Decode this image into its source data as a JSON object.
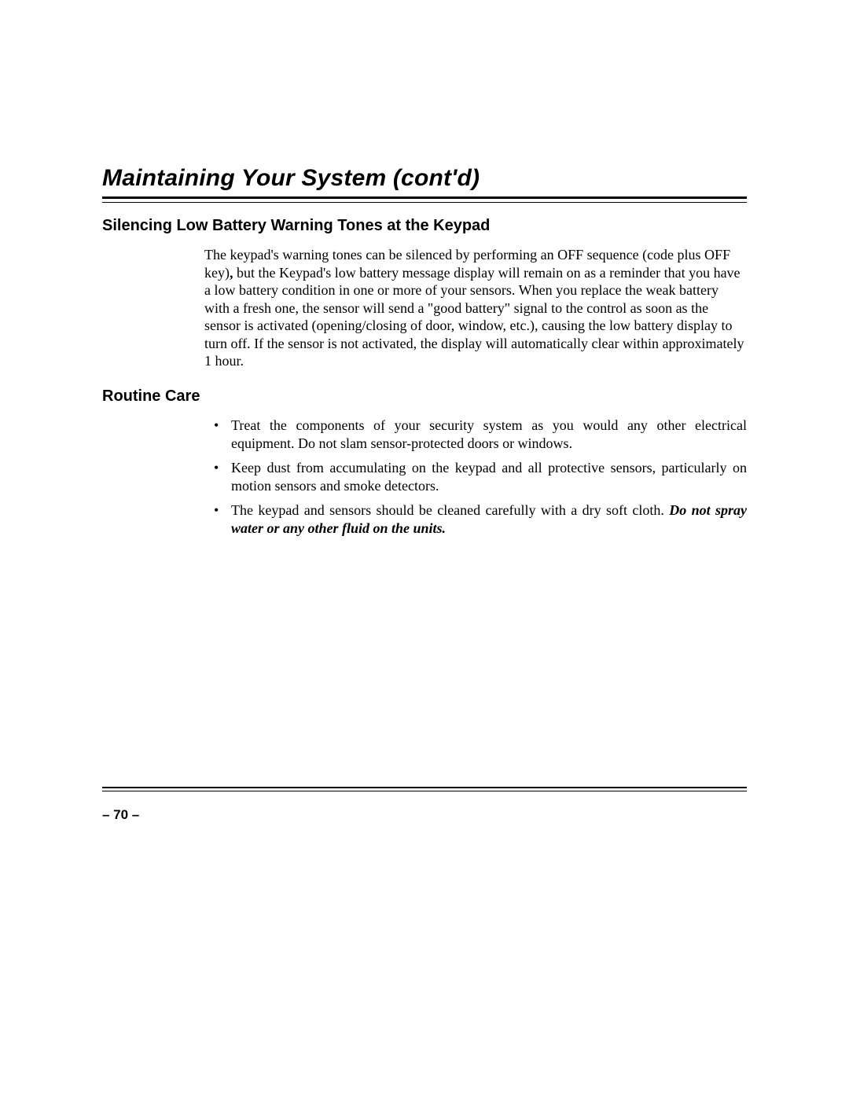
{
  "header": {
    "title": "Maintaining Your System (cont'd)"
  },
  "sections": {
    "silencing": {
      "heading": "Silencing Low Battery Warning Tones at the Keypad",
      "para_a": "The keypad's warning tones can be silenced by performing an OFF sequence (code plus OFF key)",
      "comma": ",",
      "para_b": " but the Keypad's low battery message display will remain on as a reminder that you have a low battery condition in one or more of your sensors. When you replace the weak battery with a fresh one, the sensor will send a \"good battery\" signal to the control as soon as the sensor is activated (opening/closing of door, window, etc.), causing the low battery display to turn off. If the sensor is not activated, the display will automatically clear within approximately 1 hour."
    },
    "routine": {
      "heading": "Routine Care",
      "items": [
        "Treat the components of your security system as you would any other electrical equipment. Do not slam sensor-protected doors or windows.",
        "Keep dust from accumulating on the keypad and all protective sensors, particularly on motion sensors and smoke detectors."
      ],
      "item3_lead": "The keypad and sensors should be cleaned carefully with a dry soft cloth. ",
      "item3_emph": "Do not spray water or any other fluid on the units."
    }
  },
  "footer": {
    "page_number": "– 70 –"
  }
}
